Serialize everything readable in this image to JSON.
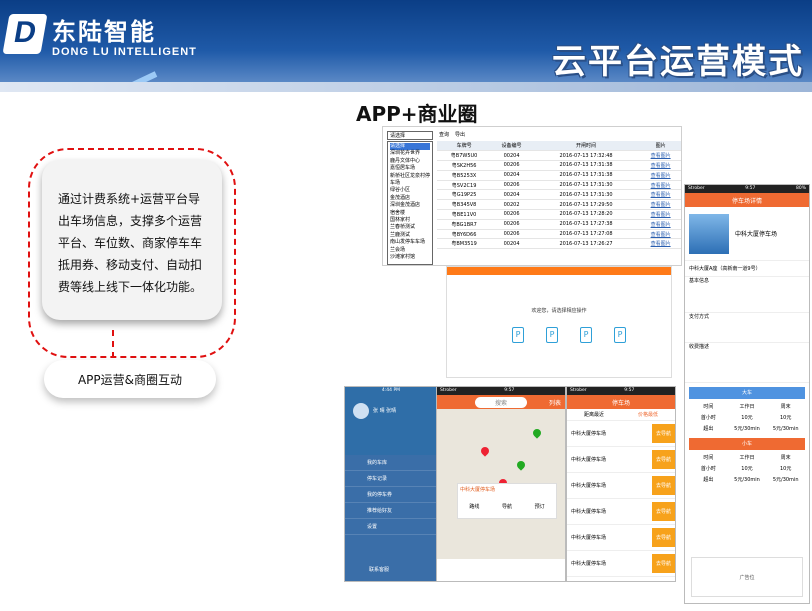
{
  "header": {
    "logo_letter": "D",
    "brand_cn": "东陆智能",
    "brand_en": "DONG LU INTELLIGENT",
    "slogan": "云平台运营模式"
  },
  "subtitle": "APP+商业圈",
  "bubble": {
    "lines": [
      "通过计费系统+运营平台导",
      "出车场信息，支撑多个运营",
      "平台、车位数、商家停车车",
      "抵用券、移动支付、自动扣",
      "费等线上线下一体化功能。"
    ]
  },
  "pill": {
    "label": "APP运营&商圈互动"
  },
  "table_panel": {
    "select_value": "请选择",
    "query_label": "查询",
    "export_label": "导出",
    "menu": [
      "请选择",
      "深圳花卉世界",
      "鹿丹文体中心",
      "嘉恒居车场",
      "新桥社区龙泉村停车场",
      "绿谷小区",
      "金茂酒店",
      "深圳金茂酒店",
      "宿舍楼",
      "国林家村",
      "兰春桥测试",
      "兰鹿测试",
      "南山发停车车场",
      "兰会场",
      "沙滩家村馆"
    ],
    "headers": [
      "车牌号",
      "设备编号",
      "开闸时间",
      "图片"
    ],
    "rows": [
      [
        "粤B7W5U0",
        "00204",
        "2016-07-13 17:32:48",
        "查看图片"
      ],
      [
        "粤SK2H56",
        "00206",
        "2016-07-13 17:31:38",
        "查看图片"
      ],
      [
        "粤B5253X",
        "00204",
        "2016-07-13 17:31:38",
        "查看图片"
      ],
      [
        "粤SV2C19",
        "00206",
        "2016-07-13 17:31:30",
        "查看图片"
      ],
      [
        "粤G19P25",
        "00204",
        "2016-07-13 17:31:30",
        "查看图片"
      ],
      [
        "粤B345V8",
        "00202",
        "2016-07-13 17:29:50",
        "查看图片"
      ],
      [
        "粤BE11V0",
        "00206",
        "2016-07-13 17:28:20",
        "查看图片"
      ],
      [
        "粤BG1BR7",
        "00206",
        "2016-07-13 17:27:38",
        "查看图片"
      ],
      [
        "粤BY6D66",
        "00206",
        "2016-07-13 17:27:08",
        "查看图片"
      ],
      [
        "粤BM3519",
        "00204",
        "2016-07-13 17:26:27",
        "查看图片"
      ]
    ]
  },
  "choose_panel": {
    "prompt": "欢迎您，请选择相应操作"
  },
  "phone_menu": {
    "time": "4:44 PM",
    "name": "张 晴  张晴",
    "items": [
      "我的车库",
      "停车记录",
      "我的停车券",
      "推荐给好友",
      "设置"
    ],
    "footer": "联系客服"
  },
  "phone_map": {
    "carrier": "Strober",
    "time": "9:57",
    "search": "搜索",
    "list_label": "列表",
    "lot_name": "中科大厦停车场",
    "actions": [
      "路线",
      "导航",
      "预订"
    ]
  },
  "phone_list": {
    "carrier": "Strober",
    "time": "9:57",
    "title": "停车场",
    "tabs": [
      "距离最近",
      "价格最低"
    ],
    "items": [
      "中科大厦停车场",
      "中科大厦停车场",
      "中科大厦停车场",
      "中科大厦停车场",
      "中科大厦停车场",
      "中科大厦停车场"
    ],
    "nav_label": "去导航"
  },
  "phone_detail": {
    "carrier": "Strober",
    "time": "9:57",
    "battery": "80%",
    "title": "停车场详情",
    "lot_name": "中科大厦停车场",
    "address": "中科大厦A座（高新南一道9号）",
    "basic": "基本信息",
    "pay": "支付方式",
    "fee": "收费描述",
    "car_small": "大车",
    "car_big": "小车",
    "cols": [
      "时间",
      "工作日",
      "周末"
    ],
    "rows_big": [
      [
        "首小时",
        "10元",
        "10元"
      ],
      [
        "超出",
        "5元/30min",
        "5元/30min"
      ]
    ],
    "rows_small": [
      [
        "首小时",
        "10元",
        "10元"
      ],
      [
        "超出",
        "5元/30min",
        "5元/30min"
      ]
    ],
    "ad": "广告位"
  }
}
